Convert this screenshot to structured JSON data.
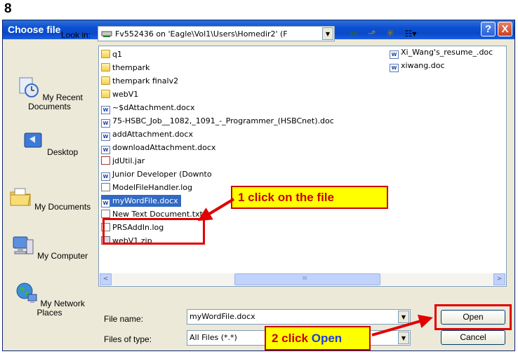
{
  "step_number": "8",
  "dialog": {
    "title": "Choose file",
    "help_glyph": "?",
    "close_glyph": "X"
  },
  "lookin": {
    "label": "Look in:",
    "value": "Fv552436 on 'Eagle\\Vol1\\Users\\Homedir2' (F",
    "dropdown_glyph": "▼"
  },
  "toolbar": {
    "icons": [
      "back-arrow-icon",
      "up-folder-icon",
      "new-folder-icon",
      "view-menu-icon"
    ],
    "glyphs": [
      "⇦",
      "⬏",
      "✳",
      "☷▾"
    ]
  },
  "places": [
    {
      "label": "My Recent Documents",
      "icon": "recent-documents-icon"
    },
    {
      "label": "Desktop",
      "icon": "desktop-icon"
    },
    {
      "label": "My Documents",
      "icon": "my-documents-icon"
    },
    {
      "label": "My Computer",
      "icon": "my-computer-icon"
    },
    {
      "label": "My Network Places",
      "icon": "network-places-icon"
    }
  ],
  "files": {
    "col1": [
      {
        "name": "q1",
        "type": "folder"
      },
      {
        "name": "thempark",
        "type": "folder"
      },
      {
        "name": "thempark finalv2",
        "type": "folder"
      },
      {
        "name": "webV1",
        "type": "folder"
      },
      {
        "name": "~$dAttachment.docx",
        "type": "docx"
      },
      {
        "name": "75-HSBC_Job__1082,_1091_-_Programmer_(HSBCnet).doc",
        "type": "docx"
      },
      {
        "name": "addAttachment.docx",
        "type": "docx"
      },
      {
        "name": "downloadAttachment.docx",
        "type": "docx"
      },
      {
        "name": "jdUtil.jar",
        "type": "jar"
      },
      {
        "name": "Junior Developer (Downto",
        "type": "docx"
      },
      {
        "name": "ModelFileHandler.log",
        "type": "txt"
      },
      {
        "name": "myWordFile.docx",
        "type": "docx",
        "selected": true
      },
      {
        "name": "New Text Document.txt",
        "type": "txt"
      },
      {
        "name": "PRSAddIn.log",
        "type": "txt"
      },
      {
        "name": "webV1.zip",
        "type": "zip"
      }
    ],
    "col2": [
      {
        "name": "Xi_Wang's_resume_.doc",
        "type": "docx"
      },
      {
        "name": "xiwang.doc",
        "type": "docx"
      }
    ]
  },
  "scroll": {
    "left_glyph": "<",
    "right_glyph": ">",
    "thumb_grip": "III"
  },
  "filename": {
    "label": "File name:",
    "value": "myWordFile.docx"
  },
  "filetype": {
    "label": "Files of type:",
    "value": "All Files (*.*)"
  },
  "buttons": {
    "open": "Open",
    "cancel": "Cancel"
  },
  "annotations": {
    "callout1": "1 click on the file",
    "callout2_prefix": "2 click ",
    "callout2_action": "Open",
    "callout_bg": "#ffff00",
    "callout_border": "#cc0000",
    "highlight_color": "#e00000"
  }
}
